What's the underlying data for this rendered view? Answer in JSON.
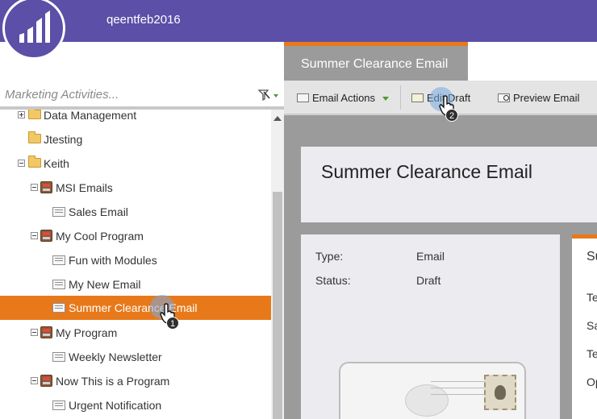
{
  "header": {
    "account_name": "qeentfeb2016"
  },
  "search": {
    "placeholder": "Marketing Activities..."
  },
  "tree": {
    "items": [
      {
        "label": "Data Management",
        "type": "folder",
        "expander": "plus"
      },
      {
        "label": "Jtesting",
        "type": "folder",
        "expander": "none"
      },
      {
        "label": "Keith",
        "type": "folder",
        "expander": "minus"
      },
      {
        "label": "MSI Emails",
        "type": "program",
        "expander": "minus"
      },
      {
        "label": "Sales Email",
        "type": "email",
        "expander": "none"
      },
      {
        "label": "My Cool Program",
        "type": "program",
        "expander": "minus"
      },
      {
        "label": "Fun with Modules",
        "type": "email",
        "expander": "none"
      },
      {
        "label": "My New Email",
        "type": "email",
        "expander": "none"
      },
      {
        "label": "Summer Clearance Email",
        "type": "email",
        "expander": "none",
        "selected": true
      },
      {
        "label": "My Program",
        "type": "program",
        "expander": "minus"
      },
      {
        "label": "Weekly Newsletter",
        "type": "email",
        "expander": "none"
      },
      {
        "label": "Now This is a Program",
        "type": "program",
        "expander": "minus"
      },
      {
        "label": "Urgent Notification",
        "type": "email",
        "expander": "none"
      }
    ]
  },
  "tab": {
    "label": "Summer Clearance Email"
  },
  "toolbar": {
    "email_actions": "Email Actions",
    "edit_draft": "Edit Draft",
    "preview_email": "Preview Email"
  },
  "asset": {
    "title": "Summer Clearance Email",
    "type_label": "Type:",
    "type_value": "Email",
    "status_label": "Status:",
    "status_value": "Draft"
  },
  "side_card": {
    "heading": "Su",
    "lines": [
      "Te",
      "Sa",
      "Te",
      "Op"
    ]
  },
  "cursors": {
    "step1": "1",
    "step2": "2"
  },
  "colors": {
    "header": "#5c4fa8",
    "accent": "#e8791a",
    "tab": "#9b9b9b",
    "green": "#4a9a32"
  }
}
